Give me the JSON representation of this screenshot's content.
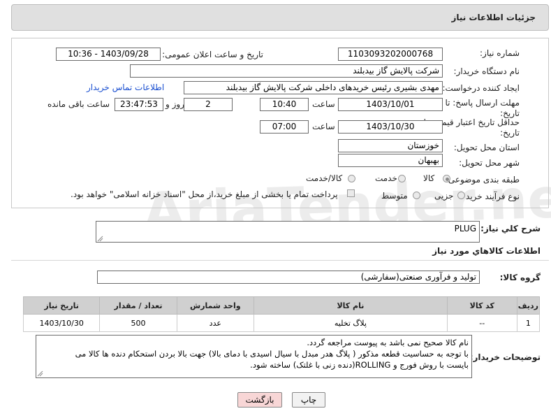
{
  "header": {
    "title": "جزئیات اطلاعات نیاز"
  },
  "form": {
    "need_number_label": "شماره نیاز:",
    "need_number": "1103093202000768",
    "announce_label": "تاریخ و ساعت اعلان عمومی:",
    "announce_value": "1403/09/28 - 10:36",
    "buyer_org_label": "نام دستگاه خریدار:",
    "buyer_org": "شرکت پالایش گاز بیدبلند",
    "creator_label": "ایجاد کننده درخواست:",
    "creator": "مهدی بشیری رئیس خریدهای داخلی شرکت پالایش گاز بیدبلند",
    "contact_link": "اطلاعات تماس خریدار",
    "deadline_label_1": "مهلت ارسال پاسخ: تا",
    "deadline_label_2": "تاریخ:",
    "deadline_date": "1403/10/01",
    "time_label": "ساعت",
    "deadline_time": "10:40",
    "days_value": "2",
    "days_label": "روز و",
    "remaining_value": "23:47:53",
    "remaining_label": "ساعت باقی مانده",
    "validity_label_1": "حداقل تاریخ اعتبار قیمت: تا",
    "validity_label_2": "تاریخ:",
    "validity_date": "1403/10/30",
    "validity_time": "07:00",
    "province_label": "استان محل تحویل:",
    "province": "خوزستان",
    "city_label": "شهر محل تحویل:",
    "city": "بهبهان",
    "category_label": "طبقه بندی موضوعی:",
    "category_options": [
      "کالا",
      "خدمت",
      "کالا/خدمت"
    ],
    "process_label": "نوع فرآیند خرید :",
    "process_options": [
      "جزیی",
      "متوسط"
    ],
    "payment_note": "پرداخت تمام یا بخشی از مبلغ خرید،از محل \"اسناد خزانه اسلامی\" خواهد بود."
  },
  "description": {
    "label": "شرح کلي نياز:",
    "value": "PLUG"
  },
  "items_section": {
    "title": "اطلاعات کالاهاي مورد نياز",
    "group_label": "گروه کالا:",
    "group_value": "تولید و فرآوری صنعتی(سفارشی)"
  },
  "table": {
    "headers": [
      "ردیف",
      "کد کالا",
      "نام کالا",
      "واحد شمارش",
      "تعداد / مقدار",
      "تاریخ نیاز"
    ],
    "rows": [
      [
        "1",
        "--",
        "پلاگ تخلیه",
        "عدد",
        "500",
        "1403/10/30"
      ]
    ]
  },
  "buyer_notes": {
    "label": "توضیحات خریدار:",
    "line1": "نام کالا صحیح نمی باشد به پیوست مراجعه گردد.",
    "line2": "با توجه به حساسیت قطعه مذکور ( پلاگ هدر مبدل با سیال اسیدی با دمای بالا) جهت بالا بردن استحکام دنده ها کالا می",
    "line3": "بایست با روش فورج و ROLLING(دنده زنی با غلتک) ساخته شود."
  },
  "buttons": {
    "print": "چاپ",
    "back": "بازگشت"
  },
  "watermark": "AriaTender.net",
  "colors": {
    "link": "#1a4fd0",
    "back_button": "#f8d6d6",
    "header_bg": "#e0e0e0"
  }
}
